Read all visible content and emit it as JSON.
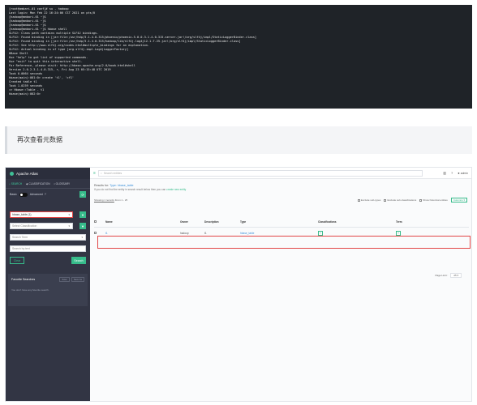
{
  "terminal": {
    "lines": [
      "[root@ambari-01 conf]# su - hadoop",
      "Last login: Mon Feb 22 16:24:06 CST 2021 on pts/0",
      "[hadoop@ambari-01 ~]$",
      "[hadoop@ambari-01 ~]$",
      "[hadoop@ambari-01 ~]$",
      "[hadoop@ambari-01 ~]$ hbase shell",
      "SLF4J: Class path contains multiple SLF4J bindings.",
      "SLF4J: Found binding in [jar:file:/usr/hdp/3.1.4.0-315/phoenix/phoenix-5.0.0.3.1.4.0-315-server.jar!/org/slf4j/impl/StaticLoggerBinder.class]",
      "SLF4J: Found binding in [jar:file:/usr/hdp/3.1.4.0-315/hadoop/lib/slf4j-log4j12-1.7.25.jar!/org/slf4j/impl/StaticLoggerBinder.class]",
      "SLF4J: See http://www.slf4j.org/codes.html#multiple_bindings for an explanation.",
      "SLF4J: Actual binding is of type [org.slf4j.impl.Log4jLoggerFactory]",
      "HBase Shell",
      "Use \"help\" to get list of supported commands.",
      "Use \"exit\" to quit this interactive shell.",
      "For Reference, please visit: http://hbase.apache.org/2.0/book.html#shell",
      "Version 2.0.2.3.1.4.0-315, r, Fri Aug 23 05:15:48 UTC 2019",
      "Took 0.0064 seconds",
      "hbase(main):001:0> create 't1', 'cf1'",
      "Created table t1",
      "Took 1.0259 seconds",
      "=> Hbase::Table - t1",
      "hbase(main):002:0>"
    ]
  },
  "caption": "再次查看元数据",
  "atlas": {
    "brand": "Apache Atlas",
    "tabs": [
      "SEARCH",
      "CLASSIFICATION",
      "GLOSSARY"
    ],
    "basic_label": "Basic",
    "advanced_label": "Advanced",
    "type_value": "hbase_table (1)",
    "classification_placeholder": "Select Classification",
    "term_placeholder": "Search Term",
    "text_placeholder": "Search by text",
    "clear_label": "Clear",
    "search_label": "Search",
    "favorites_title": "Favorite Searches",
    "favorites_chips": [
      "Save",
      "Save As"
    ],
    "favorites_empty": "You don't have any favorite search.",
    "search_placeholder": "Search entities",
    "user_label": "admin",
    "results_title_prefix": "Results for:",
    "results_title_query": "Type: hbase_table",
    "results_hint": "If you do not find the entity in search result below then you can",
    "results_hint_link": "create new entity",
    "showing": "Showing 1 records",
    "showing_suffix": "From 1 - 25",
    "filters": [
      "Exclude sub-types",
      "Exclude sub-classifications",
      "Show historical entities"
    ],
    "columns_btn": "Columns",
    "table": {
      "headers": [
        "Name",
        "Owner",
        "Description",
        "Type",
        "Classifications",
        "Term"
      ],
      "row": {
        "name": "t1",
        "owner": "hadoop",
        "description": "t1",
        "type": "hbase_table"
      }
    },
    "page_limit_label": "Page Limit :",
    "page_limit_value": "25"
  }
}
